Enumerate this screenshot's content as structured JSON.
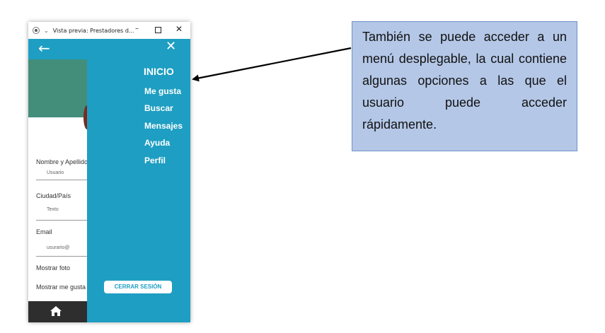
{
  "window": {
    "title": "Vista previa: Prestadores d...",
    "minimize": "–",
    "close": "✕"
  },
  "appbar": {
    "back_icon": "arrow-left-icon",
    "back_glyph": "←",
    "close_icon": "close-icon",
    "close_glyph": "✕"
  },
  "form": {
    "name_label": "Nombre y Apellido",
    "name_value": "Usuario",
    "city_label": "Ciudad/País",
    "city_value": "Texto",
    "email_label": "Email",
    "email_value": "usurario@",
    "show_photo_label": "Mostrar foto",
    "show_likes_label": "Mostrar me gusta"
  },
  "menu": {
    "title": "INICIO",
    "items": [
      "Me gusta",
      "Buscar",
      "Mensajes",
      "Ayuda",
      "Perfil"
    ],
    "logout": "CERRAR SESIÓN"
  },
  "callout": {
    "text": "También se puede acceder a un menú desplegable, la cual contiene algunas opciones a las que el usuario puede acceder rápidamente."
  },
  "colors": {
    "drawer": "#1e9ec2",
    "banner": "#438e7b",
    "bottom_nav": "#2e2e2e",
    "callout_fill": "#b4c7e7"
  }
}
